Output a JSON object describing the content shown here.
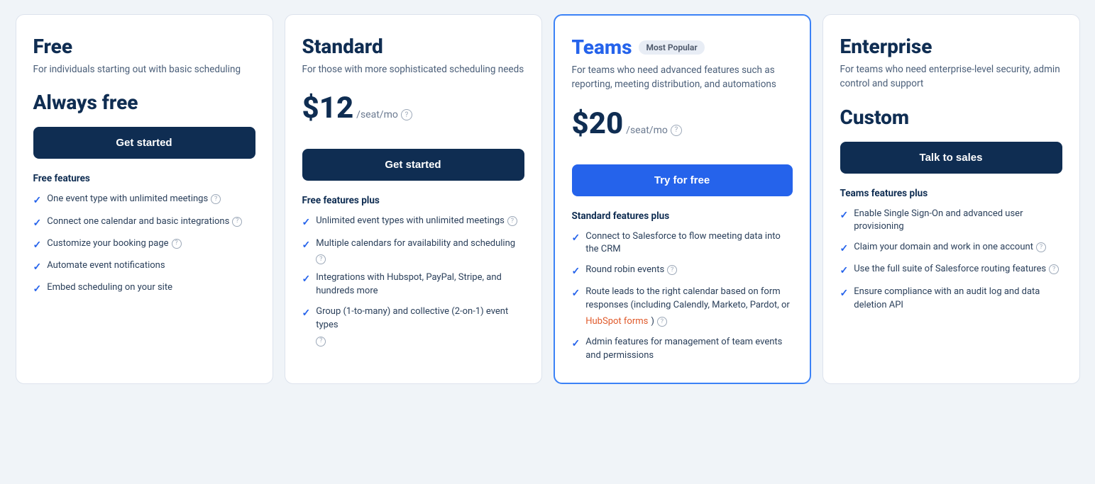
{
  "cards": [
    {
      "id": "free",
      "name": "Free",
      "nameColor": "dark",
      "mostPopular": false,
      "description": "For individuals starting out with basic scheduling",
      "priceType": "always-free",
      "priceLabel": "Always free",
      "ctaLabel": "Get started",
      "ctaType": "dark",
      "featuresLabel": "Free features",
      "features": [
        {
          "text": "One event type with unlimited meetings",
          "hasHelp": true,
          "linkText": null
        },
        {
          "text": "Connect one calendar and basic integrations",
          "hasHelp": true,
          "linkText": null
        },
        {
          "text": "Customize your booking page",
          "hasHelp": true,
          "linkText": null
        },
        {
          "text": "Automate event notifications",
          "hasHelp": false,
          "linkText": null
        },
        {
          "text": "Embed scheduling on your site",
          "hasHelp": false,
          "linkText": null
        }
      ]
    },
    {
      "id": "standard",
      "name": "Standard",
      "nameColor": "dark",
      "mostPopular": false,
      "description": "For those with more sophisticated scheduling needs",
      "priceType": "paid",
      "priceAmount": "$12",
      "priceSub": "/seat/mo",
      "ctaLabel": "Get started",
      "ctaType": "dark",
      "featuresLabel": "Free features plus",
      "features": [
        {
          "text": "Unlimited event types with unlimited meetings",
          "hasHelp": true,
          "linkText": null
        },
        {
          "text": "Multiple calendars for availability and scheduling",
          "hasHelp": true,
          "linkText": null
        },
        {
          "text": "Integrations with Hubspot, PayPal, Stripe, and hundreds more",
          "hasHelp": false,
          "linkText": null
        },
        {
          "text": "Group (1-to-many) and collective (2-on-1) event types",
          "hasHelp": true,
          "linkText": null
        }
      ]
    },
    {
      "id": "teams",
      "name": "Teams",
      "nameColor": "blue",
      "mostPopular": true,
      "mostPopularLabel": "Most Popular",
      "description": "For teams who need advanced features such as reporting, meeting distribution, and automations",
      "priceType": "paid",
      "priceAmount": "$20",
      "priceSub": "/seat/mo",
      "ctaLabel": "Try for free",
      "ctaType": "blue",
      "featuresLabel": "Standard features plus",
      "features": [
        {
          "text": "Connect to Salesforce to flow meeting data into the CRM",
          "hasHelp": false,
          "linkText": null
        },
        {
          "text": "Round robin events",
          "hasHelp": true,
          "linkText": null
        },
        {
          "text": "Route leads to the right calendar based on form responses (including Calendly, Marketo, Pardot, or HubSpot forms)",
          "hasHelp": true,
          "linkText": null,
          "hasLink": true
        },
        {
          "text": "Admin features for management of team events and permissions",
          "hasHelp": false,
          "linkText": null
        }
      ]
    },
    {
      "id": "enterprise",
      "name": "Enterprise",
      "nameColor": "dark",
      "mostPopular": false,
      "description": "For teams who need enterprise-level security, admin control and support",
      "priceType": "custom",
      "priceLabel": "Custom",
      "ctaLabel": "Talk to sales",
      "ctaType": "dark",
      "featuresLabel": "Teams features plus",
      "features": [
        {
          "text": "Enable Single Sign-On and advanced user provisioning",
          "hasHelp": false,
          "linkText": null
        },
        {
          "text": "Claim your domain and work in one account",
          "hasHelp": true,
          "linkText": null
        },
        {
          "text": "Use the full suite of Salesforce routing features",
          "hasHelp": true,
          "linkText": null
        },
        {
          "text": "Ensure compliance with an audit log and data deletion API",
          "hasHelp": false,
          "linkText": null
        }
      ]
    }
  ],
  "icons": {
    "check": "✓",
    "help": "?"
  }
}
